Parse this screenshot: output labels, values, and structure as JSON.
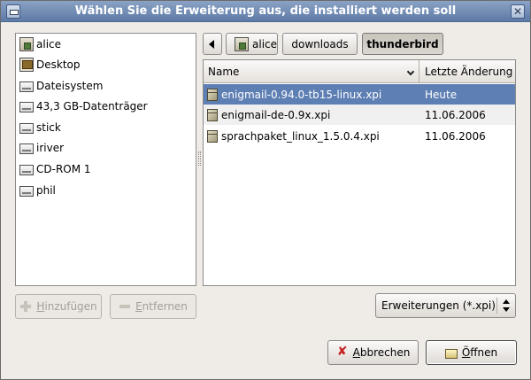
{
  "window": {
    "title": "Wählen Sie die Erweiterung aus, die installiert werden soll"
  },
  "places": [
    {
      "label": "alice",
      "icon": "home-folder-icon"
    },
    {
      "label": "Desktop",
      "icon": "desktop-icon"
    },
    {
      "label": "Dateisystem",
      "icon": "drive-icon"
    },
    {
      "label": "43,3 GB-Datenträger",
      "icon": "drive-icon"
    },
    {
      "label": "stick",
      "icon": "drive-icon"
    },
    {
      "label": "iriver",
      "icon": "drive-icon"
    },
    {
      "label": "CD-ROM 1",
      "icon": "drive-icon"
    },
    {
      "label": "phil",
      "icon": "drive-icon"
    }
  ],
  "pathbar": {
    "crumbs": [
      "alice",
      "downloads",
      "thunderbird"
    ],
    "active": "thunderbird"
  },
  "filelist": {
    "columns": [
      "Name",
      "Letzte Änderung"
    ],
    "rows": [
      {
        "name": "enigmail-0.94.0-tb15-linux.xpi",
        "modified": "Heute",
        "selected": true
      },
      {
        "name": "enigmail-de-0.9x.xpi",
        "modified": "11.06.2006",
        "selected": false
      },
      {
        "name": "sprachpaket_linux_1.5.0.4.xpi",
        "modified": "11.06.2006",
        "selected": false
      }
    ]
  },
  "buttons": {
    "add_prefix": "H",
    "add_rest": "inzufügen",
    "remove_prefix": "E",
    "remove_rest": "ntfernen",
    "cancel_prefix": "A",
    "cancel_rest": "bbrechen",
    "open_prefix": "Ö",
    "open_rest": "ffnen"
  },
  "filter": {
    "selected": "Erweiterungen (*.xpi)"
  },
  "colors": {
    "selection": "#5e7fb3",
    "titlebar": "#6f8ab4"
  }
}
